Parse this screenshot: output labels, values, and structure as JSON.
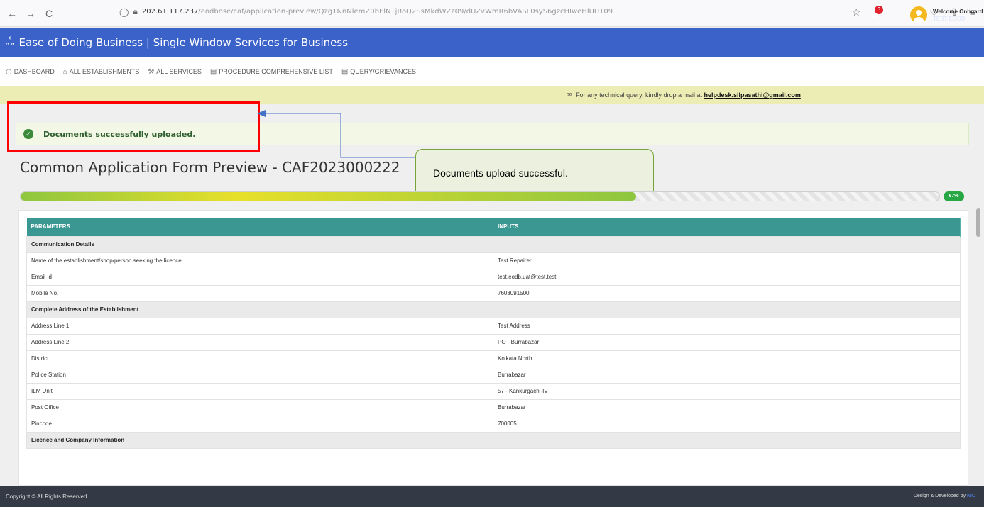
{
  "browser": {
    "back": "←",
    "forward": "→",
    "reload": "C",
    "url_host": "202.61.117.237",
    "url_path": "/eodbose/caf/application-preview/Qzg1NnNlemZ0bElNTjRoQ2SsMkdWZz09/dUZvWmR6bVASL0syS6gzcHIweHlUUT09"
  },
  "header": {
    "title": "Ease of Doing Business | Single Window Services for Business",
    "notifications": "3",
    "welcome": "Welcome Onboard",
    "user": "TEST EODB"
  },
  "menu": [
    {
      "label": "DASHBOARD",
      "icon": "dashboard-icon"
    },
    {
      "label": "ALL ESTABLISHMENTS",
      "icon": "building-icon"
    },
    {
      "label": "ALL SERVICES",
      "icon": "wrench-icon"
    },
    {
      "label": "PROCEDURE COMPREHENSIVE LIST",
      "icon": "list-icon"
    },
    {
      "label": "QUERY/GRIEVANCES",
      "icon": "list-icon"
    }
  ],
  "notice": {
    "text": "For any technical query, kindly drop a mail at",
    "email": "helpdesk.silpasathi@gmail.com"
  },
  "alert": {
    "text": "Documents successfully uploaded."
  },
  "callout": {
    "text": "Documents upload successful."
  },
  "page": {
    "title": "Common Application Form Preview - CAF2023000222"
  },
  "progress": {
    "percent": 67,
    "label": "67%"
  },
  "table": {
    "headers": [
      "PARAMETERS",
      "INPUTS"
    ],
    "sections": {
      "communication": "Communication Details",
      "address": "Complete Address of the Establishment",
      "licence": "Licence and Company Information"
    },
    "rows": [
      {
        "param": "Name of the establishment/shop/person seeking the licence",
        "value": "Test Repairer"
      },
      {
        "param": "Email Id",
        "value": "test.eodb.uat@test.test"
      },
      {
        "param": "Mobile No.",
        "value": "7603091500"
      },
      {
        "param": "Address Line 1",
        "value": "Test Address"
      },
      {
        "param": "Address Line 2",
        "value": "PO - Burrabazar"
      },
      {
        "param": "District",
        "value": "Kolkata North"
      },
      {
        "param": "Police Station",
        "value": "Burrabazar"
      },
      {
        "param": "ILM Unit",
        "value": "57 - Kankurgachi-IV"
      },
      {
        "param": "Post Office",
        "value": "Burrabazar"
      },
      {
        "param": "Pincode",
        "value": "700005"
      }
    ]
  },
  "footer": {
    "copyright": "Copyright © All Rights Reserved",
    "credit": "Design & Developed by",
    "credit_org": "NIC"
  },
  "colors": {
    "header": "#3a62c9",
    "table_header": "#3b9791",
    "alert_border": "#ff0000",
    "callout_bg": "#ebf1de",
    "callout_border": "#76a33a",
    "progress_badge": "#28a745"
  }
}
